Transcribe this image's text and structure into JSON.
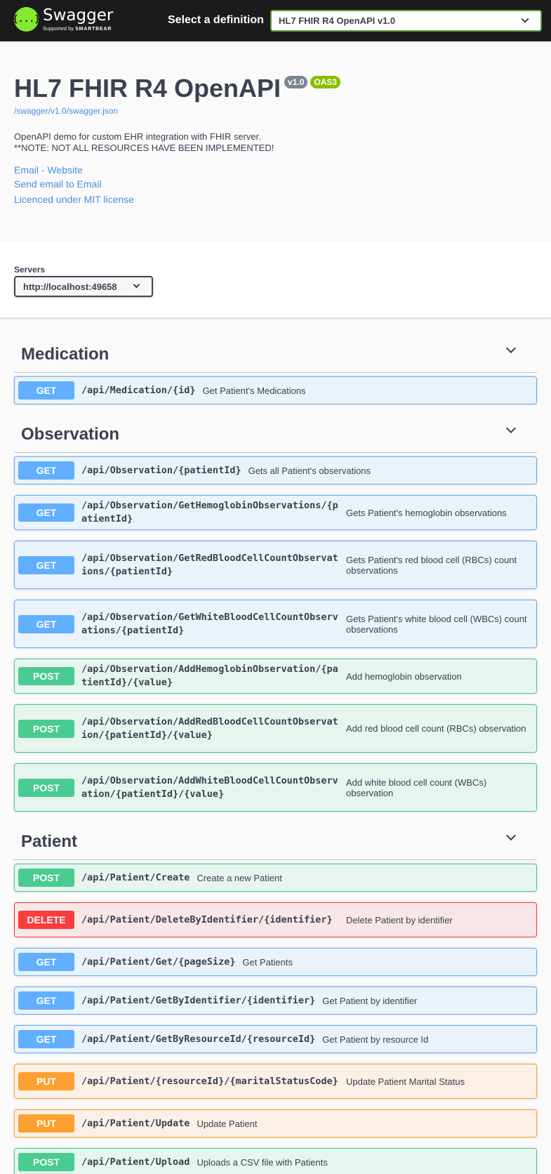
{
  "topbar": {
    "brand": "Swagger",
    "brand_sub_prefix": "Supported by",
    "brand_sub_company": "SMARTBEAR",
    "logo_glyph": "{...}",
    "select_label": "Select a definition",
    "selected_definition": "HL7 FHIR R4 OpenAPI v1.0"
  },
  "info": {
    "title": "HL7 FHIR R4 OpenAPI",
    "version": "v1.0",
    "oas": "OAS3",
    "url": "/swagger/v1.0/swagger.json",
    "description_1": "OpenAPI demo for custom EHR integration with FHIR server.",
    "description_2": "**NOTE: NOT ALL RESOURCES HAVE BEEN IMPLEMENTED!",
    "link_website": "Email - Website",
    "link_email": "Send email to Email",
    "link_license": "Licenced under MIT license"
  },
  "servers": {
    "label": "Servers",
    "selected": "http://localhost:49658"
  },
  "tags": [
    {
      "name": "Medication",
      "operations": [
        {
          "method": "GET",
          "path": "/api/Medication/{id}",
          "summary": "Get Patient's Medications"
        }
      ]
    },
    {
      "name": "Observation",
      "operations": [
        {
          "method": "GET",
          "path": "/api/Observation/{patientId}",
          "summary": "Gets all Patient's observations"
        },
        {
          "method": "GET",
          "path": "/api/Observation/GetHemoglobinObservations/{patientId}",
          "summary": "Gets Patient's hemoglobin observations"
        },
        {
          "method": "GET",
          "path": "/api/Observation/GetRedBloodCellCountObservations/{patientId}",
          "summary": "Gets Patient's red blood cell (RBCs) count observations"
        },
        {
          "method": "GET",
          "path": "/api/Observation/GetWhiteBloodCellCountObservations/{patientId}",
          "summary": "Gets Patient's white blood cell (WBCs) count observations"
        },
        {
          "method": "POST",
          "path": "/api/Observation/AddHemoglobinObservation/{patientId}/{value}",
          "summary": "Add hemoglobin observation"
        },
        {
          "method": "POST",
          "path": "/api/Observation/AddRedBloodCellCountObservation/{patientId}/{value}",
          "summary": "Add red blood cell count (RBCs) observation"
        },
        {
          "method": "POST",
          "path": "/api/Observation/AddWhiteBloodCellCountObservation/{patientId}/{value}",
          "summary": "Add white blood cell count (WBCs) observation"
        }
      ]
    },
    {
      "name": "Patient",
      "operations": [
        {
          "method": "POST",
          "path": "/api/Patient/Create",
          "summary": "Create a new Patient"
        },
        {
          "method": "DELETE",
          "path": "/api/Patient/DeleteByIdentifier/{identifier}",
          "summary": "Delete Patient by identifier"
        },
        {
          "method": "GET",
          "path": "/api/Patient/Get/{pageSize}",
          "summary": "Get Patients"
        },
        {
          "method": "GET",
          "path": "/api/Patient/GetByIdentifier/{identifier}",
          "summary": "Get Patient by identifier"
        },
        {
          "method": "GET",
          "path": "/api/Patient/GetByResourceId/{resourceId}",
          "summary": "Get Patient by resource Id"
        },
        {
          "method": "PUT",
          "path": "/api/Patient/{resourceId}/{maritalStatusCode}",
          "summary": "Update Patient Marital Status"
        },
        {
          "method": "PUT",
          "path": "/api/Patient/Update",
          "summary": "Update Patient"
        },
        {
          "method": "POST",
          "path": "/api/Patient/Upload",
          "summary": "Uploads a CSV file with Patients"
        }
      ]
    }
  ],
  "colors": {
    "get": "#61affe",
    "post": "#49cc90",
    "delete": "#f93e3e",
    "put": "#fca130",
    "topbar": "#1b1b1b",
    "brand_green": "#85ea2d",
    "oas_badge": "#89bf04",
    "version_badge": "#7d8492",
    "link": "#4990e2"
  }
}
